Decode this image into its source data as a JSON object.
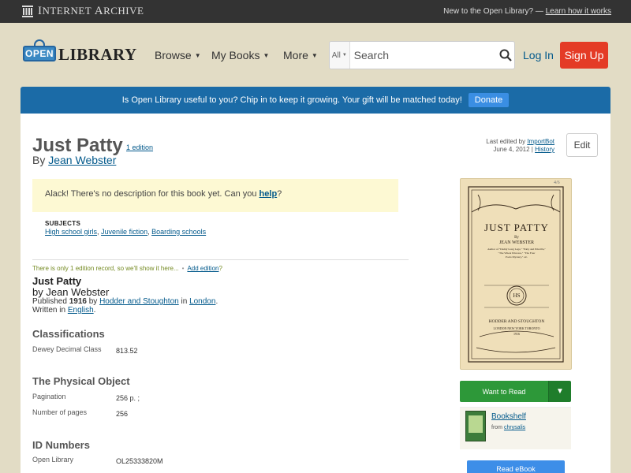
{
  "topbar": {
    "ia_brand_first": "I",
    "ia_brand_rest": "NTERNET ",
    "ia_brand_first2": "A",
    "ia_brand_rest2": "RCHIVE",
    "new_text": "New to the Open Library? — ",
    "learn_link": "Learn how it works"
  },
  "header": {
    "logo_open": "OPEN",
    "logo_library": "LIBRARY",
    "nav": [
      {
        "label": "Browse"
      },
      {
        "label": "My Books"
      },
      {
        "label": "More"
      }
    ],
    "search_scope": "All",
    "search_placeholder": "Search",
    "login": "Log In",
    "signup": "Sign Up"
  },
  "banner": {
    "text": "Is Open Library useful to you? Chip in to keep it growing. Your gift will be matched today!",
    "donate": "Donate"
  },
  "work": {
    "title": "Just Patty",
    "edition_count": "1 edition",
    "by": "By ",
    "author": "Jean Webster",
    "last_edited_prefix": "Last edited by ",
    "last_edited_by": "ImportBot",
    "last_edited_date": "June 4, 2012 | ",
    "history": "History",
    "edit": "Edit",
    "no_desc_text": "Alack! There's no description for this book yet. Can you ",
    "no_desc_help": "help",
    "no_desc_end": "?",
    "subjects_label": "SUBJECTS",
    "subjects": [
      "High school girls",
      "Juvenile fiction",
      "Boarding schools"
    ]
  },
  "edition": {
    "only_one": "There is only 1 edition record, so we'll show it here...",
    "separator": "•",
    "add_edition": "Add edition",
    "add_edition_q": "?",
    "title": "Just Patty",
    "by": "by Jean Webster",
    "published_prefix": "Published ",
    "published_year": "1916",
    "published_by": " by ",
    "publisher": "Hodder and Stoughton",
    "published_in": " in ",
    "place": "London",
    "published_end": ".",
    "written_prefix": "Written in ",
    "language": "English",
    "written_end": "."
  },
  "details": {
    "classifications_title": "Classifications",
    "dewey_label": "Dewey Decimal Class",
    "dewey_value": "813.52",
    "physical_title": "The Physical Object",
    "pagination_label": "Pagination",
    "pagination_value": "256 p. ;",
    "pages_label": "Number of pages",
    "pages_value": "256",
    "id_title": "ID Numbers",
    "ol_label": "Open Library",
    "ol_value": "OL25333820M"
  },
  "cover": {
    "title": "JUST PATTY",
    "by": "By",
    "author": "JEAN WEBSTER",
    "blurb1": "Author of \"Daddy Long Legs,\" \"Patty and Priscilla,\"",
    "blurb2": "\"The Wheat Princess,\" \"The Four",
    "blurb3": "Pools Mystery,\" etc.",
    "publisher": "HODDER AND STOUGHTON",
    "cities": "LONDON NEW YORK TORONTO",
    "year": "1916",
    "mark": "HS",
    "pencil": "4/6"
  },
  "sidebar": {
    "want_to_read": "Want to Read",
    "shelf_name": "Bookshelf",
    "shelf_from_prefix": "from ",
    "shelf_from": "chrysalis",
    "read_ebook": "Read eBook"
  },
  "colors": {
    "topbar": "#333333",
    "header_bg": "#e2dcc5",
    "banner": "#1b6ba7",
    "signup": "#e43b26",
    "want_to_read": "#2d9839",
    "read_ebook": "#3d8ee8",
    "link": "#02598b"
  }
}
